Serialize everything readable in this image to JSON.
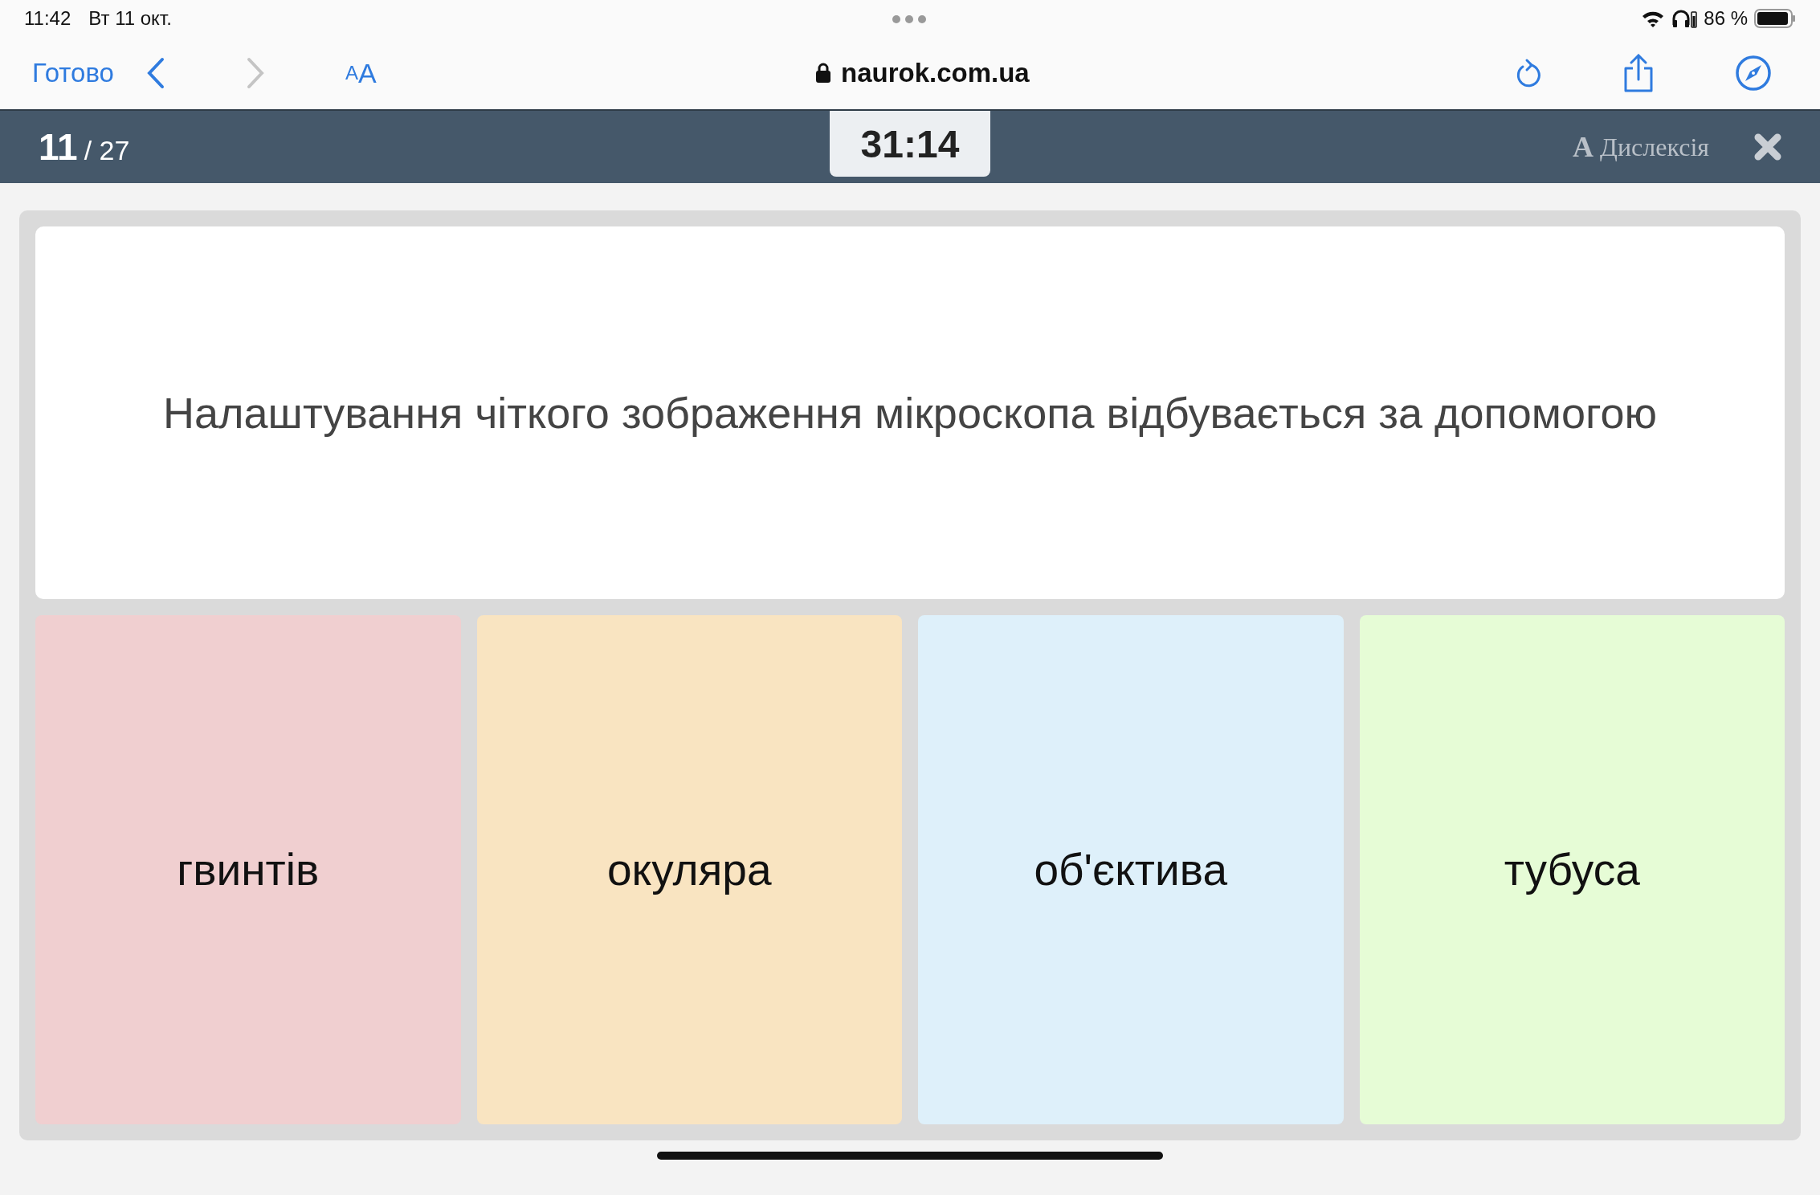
{
  "status_bar": {
    "time": "11:42",
    "date": "Вт 11 окт.",
    "battery": "86 %"
  },
  "browser_toolbar": {
    "done": "Готово",
    "text_size": "AA",
    "url": "naurok.com.ua",
    "back_disabled": false,
    "forward_disabled": true
  },
  "quiz_header": {
    "current": "11",
    "total": "/ 27",
    "timer": "31:14",
    "dyslexia_glyph": "A",
    "dyslexia_label": "Дислексія"
  },
  "question": "Налаштування чіткого зображення мікроскопа відбувається за допомогою",
  "answers": [
    {
      "text": "гвинтів",
      "color": "#f0cfd0"
    },
    {
      "text": "окуляра",
      "color": "#f9e4c1"
    },
    {
      "text": "об'єктива",
      "color": "#def0fa"
    },
    {
      "text": "тубуса",
      "color": "#e6fcd6"
    }
  ]
}
